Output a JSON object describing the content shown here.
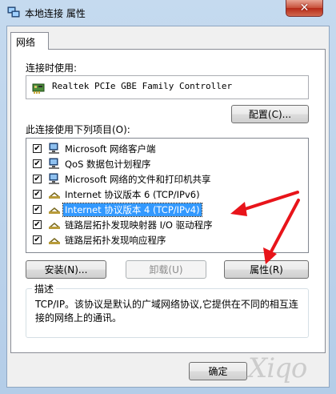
{
  "window": {
    "title": "本地连接 属性",
    "close_glyph": "✕"
  },
  "tabs": [
    {
      "label": "网络"
    }
  ],
  "connect_using": {
    "label": "连接时使用:",
    "adapter_name": "Realtek PCIe GBE Family Controller",
    "configure_button": "配置(C)..."
  },
  "items_section": {
    "label": "此连接使用下列项目(O):",
    "items": [
      {
        "label": "Microsoft 网络客户端",
        "checked": true,
        "icon": "network-client-icon"
      },
      {
        "label": "QoS 数据包计划程序",
        "checked": true,
        "icon": "qos-scheduler-icon"
      },
      {
        "label": "Microsoft 网络的文件和打印机共享",
        "checked": true,
        "icon": "file-printer-sharing-icon"
      },
      {
        "label": "Internet 协议版本 6 (TCP/IPv6)",
        "checked": true,
        "icon": "protocol-icon"
      },
      {
        "label": "Internet 协议版本 4 (TCP/IPv4)",
        "checked": true,
        "icon": "protocol-icon",
        "selected": true
      },
      {
        "label": "链路层拓扑发现映射器 I/O 驱动程序",
        "checked": true,
        "icon": "protocol-icon"
      },
      {
        "label": "链路层拓扑发现响应程序",
        "checked": true,
        "icon": "protocol-icon"
      }
    ],
    "check_glyph": "✔"
  },
  "actions": {
    "install": "安装(N)...",
    "uninstall": "卸载(U)",
    "properties": "属性(R)"
  },
  "description": {
    "title": "描述",
    "text": "TCP/IP。该协议是默认的广域网络协议,它提供在不同的相互连接的网络上的通讯。"
  },
  "footer": {
    "ok_button": "确定"
  },
  "watermark": "Xiqo",
  "colors": {
    "selection": "#3399ff",
    "annotation_arrow": "#e8141a",
    "close_button": "#c7503a"
  }
}
